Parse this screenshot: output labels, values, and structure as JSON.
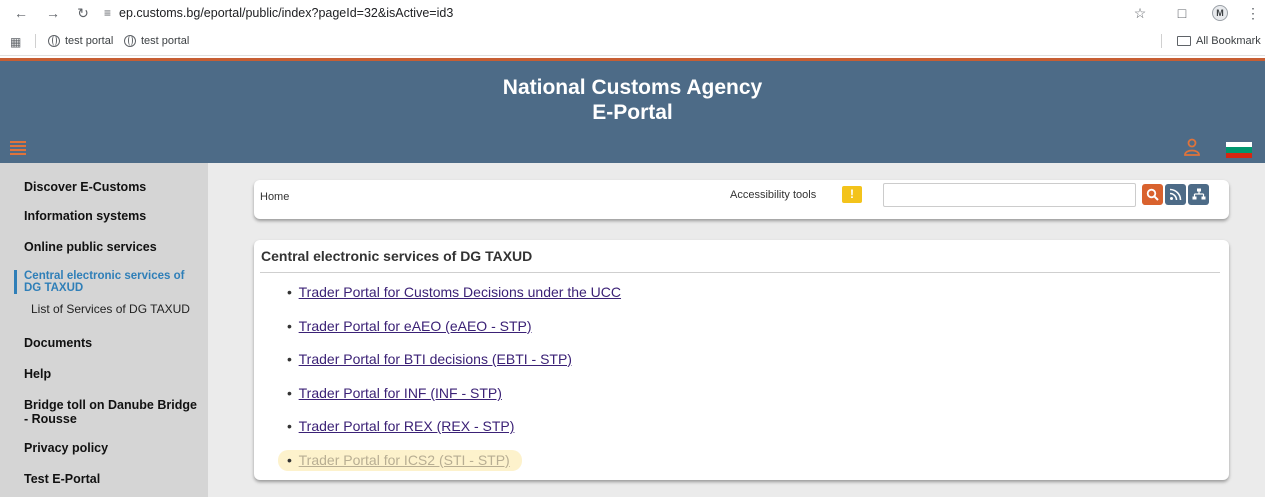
{
  "browser": {
    "url_domain": "ep.customs.bg",
    "url_path": "/eportal/public/index?pageId=32&isActive=id3",
    "avatar_letter": "M",
    "bookmarks": [
      "test portal",
      "test portal"
    ],
    "all_bookmarks_label": "All Bookmark"
  },
  "header": {
    "title_line1": "National Customs Agency",
    "title_line2": "E-Portal",
    "bg_color": "#4d6b87",
    "accent_color": "#e0733a"
  },
  "sidebar": {
    "items": [
      "Discover E-Customs",
      "Information systems",
      "Online public services",
      "Documents",
      "Help",
      "Bridge toll on Danube Bridge",
      "- Rousse",
      "Privacy policy",
      "Test E-Portal"
    ],
    "active_line1": "Central electronic services of",
    "active_line2": "DG TAXUD",
    "sub_item": "List of Services of DG TAXUD"
  },
  "breadcrumb": {
    "home": "Home",
    "accessibility": "Accessibility tools"
  },
  "services": {
    "title": "Central electronic services of DG TAXUD",
    "links": [
      "Trader Portal for Customs Decisions under the UCC",
      "Trader Portal for eAEO (eAEO - STP)",
      "Trader Portal for BTI decisions (EBTI - STP)",
      "Trader Portal for INF (INF - STP)",
      "Trader Portal for REX (REX - STP)",
      "Trader Portal for ICS2 (STI - STP)"
    ],
    "bullet": "•"
  }
}
